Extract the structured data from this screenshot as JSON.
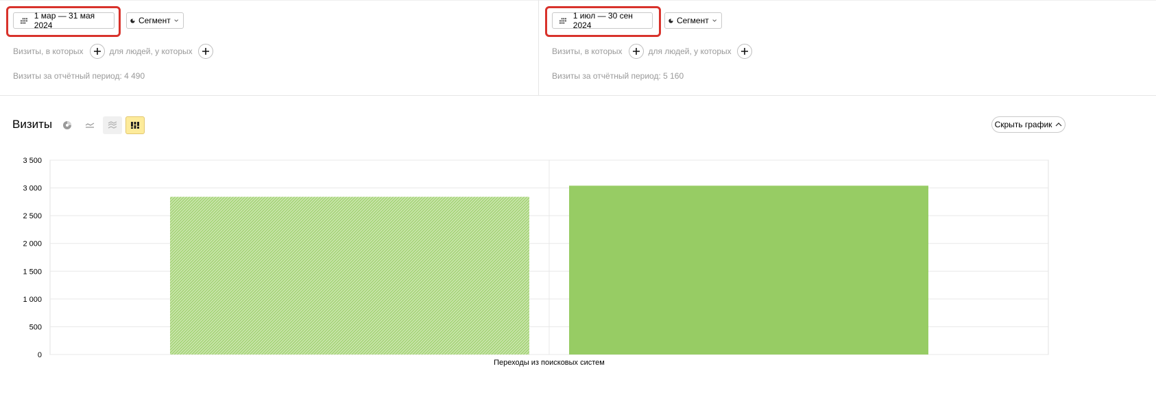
{
  "left_panel": {
    "date_range": "1 мар — 31 мая 2024",
    "segment_label": "Сегмент",
    "filter_visits": "Визиты, в которых",
    "filter_people": "для людей, у которых",
    "period_text": "Визиты за отчётный период: 4 490"
  },
  "right_panel": {
    "date_range": "1 июл — 30 сен 2024",
    "segment_label": "Сегмент",
    "filter_visits": "Визиты, в которых",
    "filter_people": "для людей, у которых",
    "period_text": "Визиты за отчётный период: 5 160"
  },
  "chart_section": {
    "title": "Визиты",
    "hide_chart_label": "Скрыть график",
    "view_icons": [
      "pie-chart-icon",
      "line-chart-icon",
      "area-chart-icon",
      "bar-chart-icon"
    ],
    "active_view": "bar-chart-icon"
  },
  "colors": {
    "highlight": "#d8322b",
    "bar": "#97cc64",
    "active_view_bg": "#fdeb9b"
  },
  "chart_data": {
    "type": "bar",
    "categories": [
      "Переходы из поисковых систем"
    ],
    "series": [
      {
        "values": [
          2840
        ],
        "pattern": "hatched"
      },
      {
        "values": [
          3040
        ],
        "pattern": "solid"
      }
    ],
    "yticks": [
      "0",
      "500",
      "1 000",
      "1 500",
      "2 000",
      "2 500",
      "3 000",
      "3 500"
    ],
    "ylim": [
      0,
      3500
    ],
    "grid": true
  }
}
